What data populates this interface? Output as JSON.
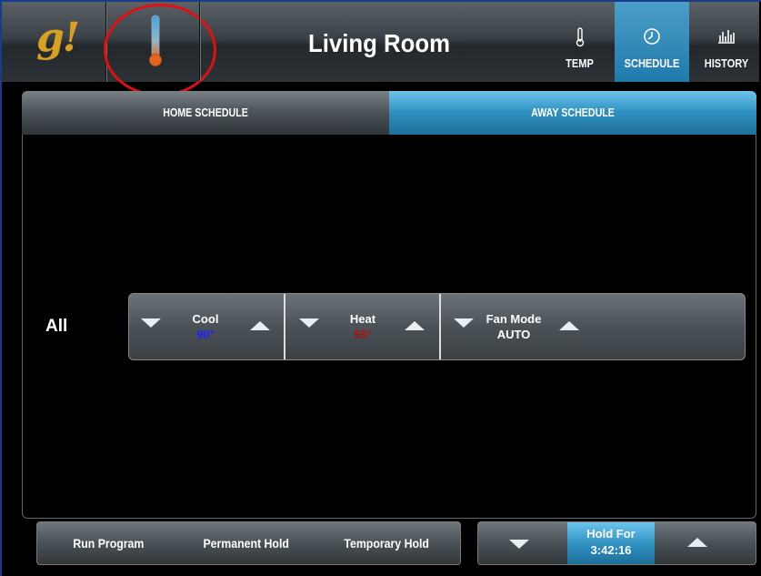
{
  "header": {
    "logo": "g!",
    "title": "Living Room",
    "nav": [
      {
        "label": "TEMP",
        "icon": "thermometer-icon"
      },
      {
        "label": "SCHEDULE",
        "icon": "clock-icon",
        "active": true
      },
      {
        "label": "HISTORY",
        "icon": "bar-chart-icon"
      }
    ]
  },
  "tabs": {
    "home": "HOME SCHEDULE",
    "away": "AWAY SCHEDULE",
    "active": "away"
  },
  "schedule": {
    "row_label": "All",
    "cool": {
      "name": "Cool",
      "value": "90°",
      "color": "#2020ff"
    },
    "heat": {
      "name": "Heat",
      "value": "55°",
      "color": "#b01010"
    },
    "fan": {
      "name": "Fan Mode",
      "value": "AUTO"
    }
  },
  "holds": {
    "run_program": "Run Program",
    "permanent_hold": "Permanent Hold",
    "temporary_hold": "Temporary Hold",
    "hold_for_label": "Hold For",
    "hold_for_time": "3:42:16"
  },
  "colors": {
    "accent": "#2d8fc0",
    "annotation": "#e01010",
    "logo": "#d9a022"
  }
}
